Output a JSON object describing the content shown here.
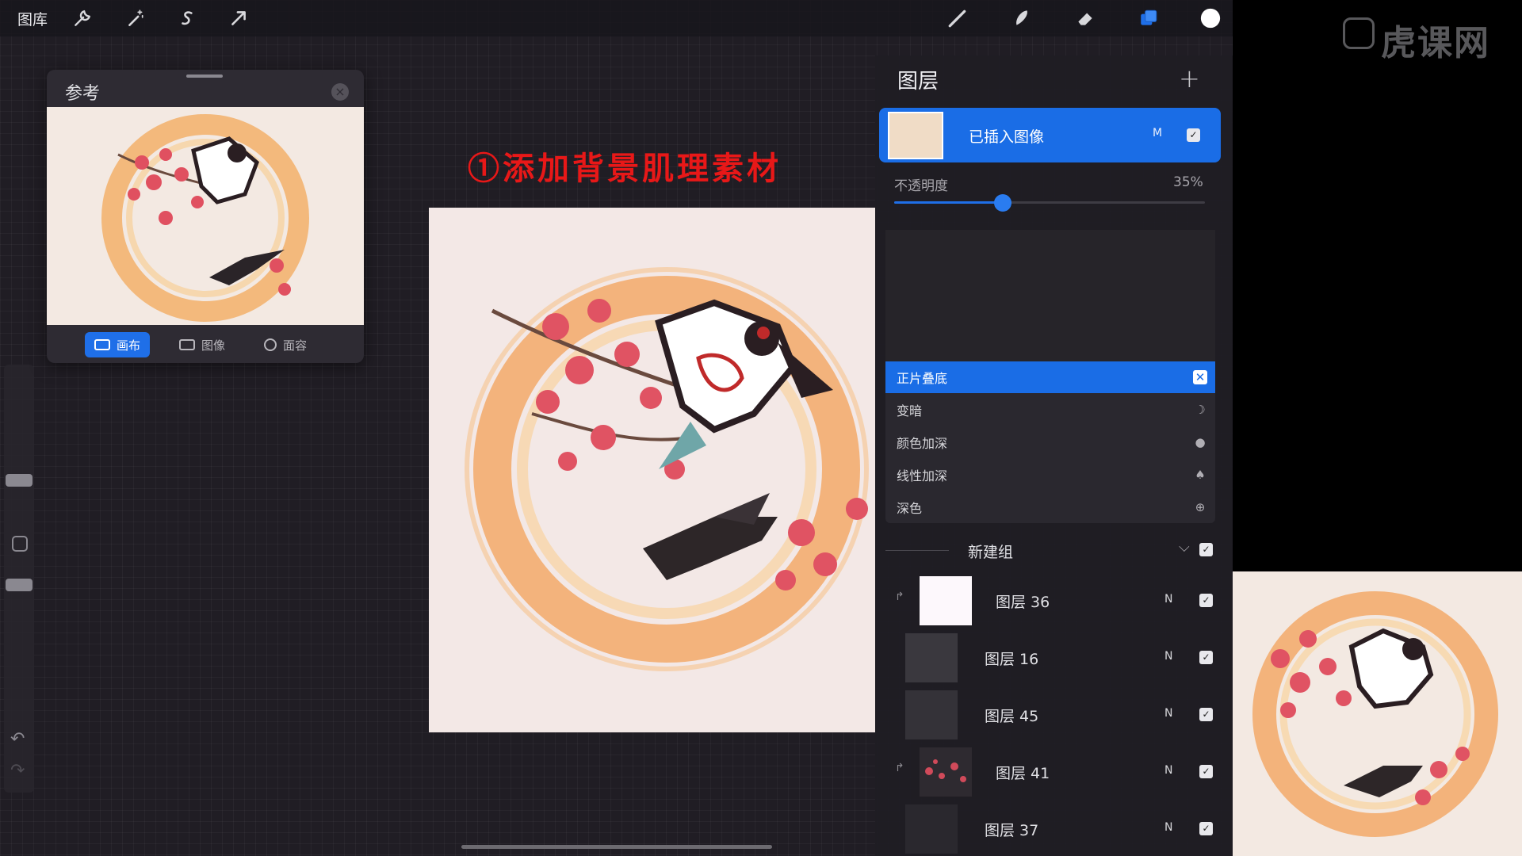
{
  "toolbar": {
    "gallery_label": "图库",
    "icons": [
      "wrench-icon",
      "magic-wand-icon",
      "selection-icon",
      "transform-arrow-icon",
      "brush-icon",
      "smudge-icon",
      "eraser-icon",
      "layers-icon",
      "color-swatch-icon"
    ],
    "active_color": "#ffffff",
    "accent": "#1f6fe8"
  },
  "reference": {
    "title": "参考",
    "tabs": [
      {
        "label": "画布",
        "active": true
      },
      {
        "label": "图像",
        "active": false
      },
      {
        "label": "面容",
        "active": false
      }
    ]
  },
  "annotation": {
    "text": "①添加背景肌理素材",
    "color": "#e81818"
  },
  "layers": {
    "title": "图层",
    "active_layer": {
      "name": "已插入图像",
      "blend": "M",
      "visible": true
    },
    "opacity": {
      "label": "不透明度",
      "value_text": "35%",
      "value": 0.35
    },
    "blend_modes": [
      {
        "label": "正片叠底",
        "selected": true,
        "icon": "multiply-icon"
      },
      {
        "label": "变暗",
        "selected": false,
        "icon": "moon-icon"
      },
      {
        "label": "颜色加深",
        "selected": false,
        "icon": "burn-icon"
      },
      {
        "label": "线性加深",
        "selected": false,
        "icon": "flame-icon"
      },
      {
        "label": "深色",
        "selected": false,
        "icon": "dark-circle-icon"
      }
    ],
    "group": {
      "name": "新建组",
      "visible": true
    },
    "items": [
      {
        "name": "图层 36",
        "blend": "N",
        "visible": true,
        "clipped": true,
        "thumb": "#fdf8fc"
      },
      {
        "name": "图层 16",
        "blend": "N",
        "visible": true,
        "clipped": false,
        "thumb": "#3a383e"
      },
      {
        "name": "图层 45",
        "blend": "N",
        "visible": true,
        "clipped": false,
        "thumb": "#343238"
      },
      {
        "name": "图层 41",
        "blend": "N",
        "visible": true,
        "clipped": true,
        "thumb": "#2e2a30"
      },
      {
        "name": "图层 37",
        "blend": "N",
        "visible": true,
        "clipped": false,
        "thumb": "#2a282e"
      }
    ]
  },
  "watermark": {
    "text": "虎课网"
  }
}
